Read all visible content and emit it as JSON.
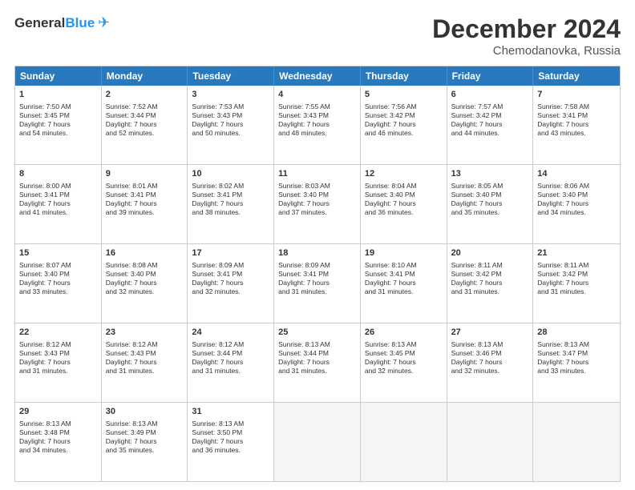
{
  "header": {
    "logo_general": "General",
    "logo_blue": "Blue",
    "month_title": "December 2024",
    "location": "Chemodanovka, Russia"
  },
  "weekdays": [
    "Sunday",
    "Monday",
    "Tuesday",
    "Wednesday",
    "Thursday",
    "Friday",
    "Saturday"
  ],
  "rows": [
    [
      {
        "day": "1",
        "lines": [
          "Sunrise: 7:50 AM",
          "Sunset: 3:45 PM",
          "Daylight: 7 hours",
          "and 54 minutes."
        ]
      },
      {
        "day": "2",
        "lines": [
          "Sunrise: 7:52 AM",
          "Sunset: 3:44 PM",
          "Daylight: 7 hours",
          "and 52 minutes."
        ]
      },
      {
        "day": "3",
        "lines": [
          "Sunrise: 7:53 AM",
          "Sunset: 3:43 PM",
          "Daylight: 7 hours",
          "and 50 minutes."
        ]
      },
      {
        "day": "4",
        "lines": [
          "Sunrise: 7:55 AM",
          "Sunset: 3:43 PM",
          "Daylight: 7 hours",
          "and 48 minutes."
        ]
      },
      {
        "day": "5",
        "lines": [
          "Sunrise: 7:56 AM",
          "Sunset: 3:42 PM",
          "Daylight: 7 hours",
          "and 46 minutes."
        ]
      },
      {
        "day": "6",
        "lines": [
          "Sunrise: 7:57 AM",
          "Sunset: 3:42 PM",
          "Daylight: 7 hours",
          "and 44 minutes."
        ]
      },
      {
        "day": "7",
        "lines": [
          "Sunrise: 7:58 AM",
          "Sunset: 3:41 PM",
          "Daylight: 7 hours",
          "and 43 minutes."
        ]
      }
    ],
    [
      {
        "day": "8",
        "lines": [
          "Sunrise: 8:00 AM",
          "Sunset: 3:41 PM",
          "Daylight: 7 hours",
          "and 41 minutes."
        ]
      },
      {
        "day": "9",
        "lines": [
          "Sunrise: 8:01 AM",
          "Sunset: 3:41 PM",
          "Daylight: 7 hours",
          "and 39 minutes."
        ]
      },
      {
        "day": "10",
        "lines": [
          "Sunrise: 8:02 AM",
          "Sunset: 3:41 PM",
          "Daylight: 7 hours",
          "and 38 minutes."
        ]
      },
      {
        "day": "11",
        "lines": [
          "Sunrise: 8:03 AM",
          "Sunset: 3:40 PM",
          "Daylight: 7 hours",
          "and 37 minutes."
        ]
      },
      {
        "day": "12",
        "lines": [
          "Sunrise: 8:04 AM",
          "Sunset: 3:40 PM",
          "Daylight: 7 hours",
          "and 36 minutes."
        ]
      },
      {
        "day": "13",
        "lines": [
          "Sunrise: 8:05 AM",
          "Sunset: 3:40 PM",
          "Daylight: 7 hours",
          "and 35 minutes."
        ]
      },
      {
        "day": "14",
        "lines": [
          "Sunrise: 8:06 AM",
          "Sunset: 3:40 PM",
          "Daylight: 7 hours",
          "and 34 minutes."
        ]
      }
    ],
    [
      {
        "day": "15",
        "lines": [
          "Sunrise: 8:07 AM",
          "Sunset: 3:40 PM",
          "Daylight: 7 hours",
          "and 33 minutes."
        ]
      },
      {
        "day": "16",
        "lines": [
          "Sunrise: 8:08 AM",
          "Sunset: 3:40 PM",
          "Daylight: 7 hours",
          "and 32 minutes."
        ]
      },
      {
        "day": "17",
        "lines": [
          "Sunrise: 8:09 AM",
          "Sunset: 3:41 PM",
          "Daylight: 7 hours",
          "and 32 minutes."
        ]
      },
      {
        "day": "18",
        "lines": [
          "Sunrise: 8:09 AM",
          "Sunset: 3:41 PM",
          "Daylight: 7 hours",
          "and 31 minutes."
        ]
      },
      {
        "day": "19",
        "lines": [
          "Sunrise: 8:10 AM",
          "Sunset: 3:41 PM",
          "Daylight: 7 hours",
          "and 31 minutes."
        ]
      },
      {
        "day": "20",
        "lines": [
          "Sunrise: 8:11 AM",
          "Sunset: 3:42 PM",
          "Daylight: 7 hours",
          "and 31 minutes."
        ]
      },
      {
        "day": "21",
        "lines": [
          "Sunrise: 8:11 AM",
          "Sunset: 3:42 PM",
          "Daylight: 7 hours",
          "and 31 minutes."
        ]
      }
    ],
    [
      {
        "day": "22",
        "lines": [
          "Sunrise: 8:12 AM",
          "Sunset: 3:43 PM",
          "Daylight: 7 hours",
          "and 31 minutes."
        ]
      },
      {
        "day": "23",
        "lines": [
          "Sunrise: 8:12 AM",
          "Sunset: 3:43 PM",
          "Daylight: 7 hours",
          "and 31 minutes."
        ]
      },
      {
        "day": "24",
        "lines": [
          "Sunrise: 8:12 AM",
          "Sunset: 3:44 PM",
          "Daylight: 7 hours",
          "and 31 minutes."
        ]
      },
      {
        "day": "25",
        "lines": [
          "Sunrise: 8:13 AM",
          "Sunset: 3:44 PM",
          "Daylight: 7 hours",
          "and 31 minutes."
        ]
      },
      {
        "day": "26",
        "lines": [
          "Sunrise: 8:13 AM",
          "Sunset: 3:45 PM",
          "Daylight: 7 hours",
          "and 32 minutes."
        ]
      },
      {
        "day": "27",
        "lines": [
          "Sunrise: 8:13 AM",
          "Sunset: 3:46 PM",
          "Daylight: 7 hours",
          "and 32 minutes."
        ]
      },
      {
        "day": "28",
        "lines": [
          "Sunrise: 8:13 AM",
          "Sunset: 3:47 PM",
          "Daylight: 7 hours",
          "and 33 minutes."
        ]
      }
    ],
    [
      {
        "day": "29",
        "lines": [
          "Sunrise: 8:13 AM",
          "Sunset: 3:48 PM",
          "Daylight: 7 hours",
          "and 34 minutes."
        ]
      },
      {
        "day": "30",
        "lines": [
          "Sunrise: 8:13 AM",
          "Sunset: 3:49 PM",
          "Daylight: 7 hours",
          "and 35 minutes."
        ]
      },
      {
        "day": "31",
        "lines": [
          "Sunrise: 8:13 AM",
          "Sunset: 3:50 PM",
          "Daylight: 7 hours",
          "and 36 minutes."
        ]
      },
      null,
      null,
      null,
      null
    ]
  ]
}
